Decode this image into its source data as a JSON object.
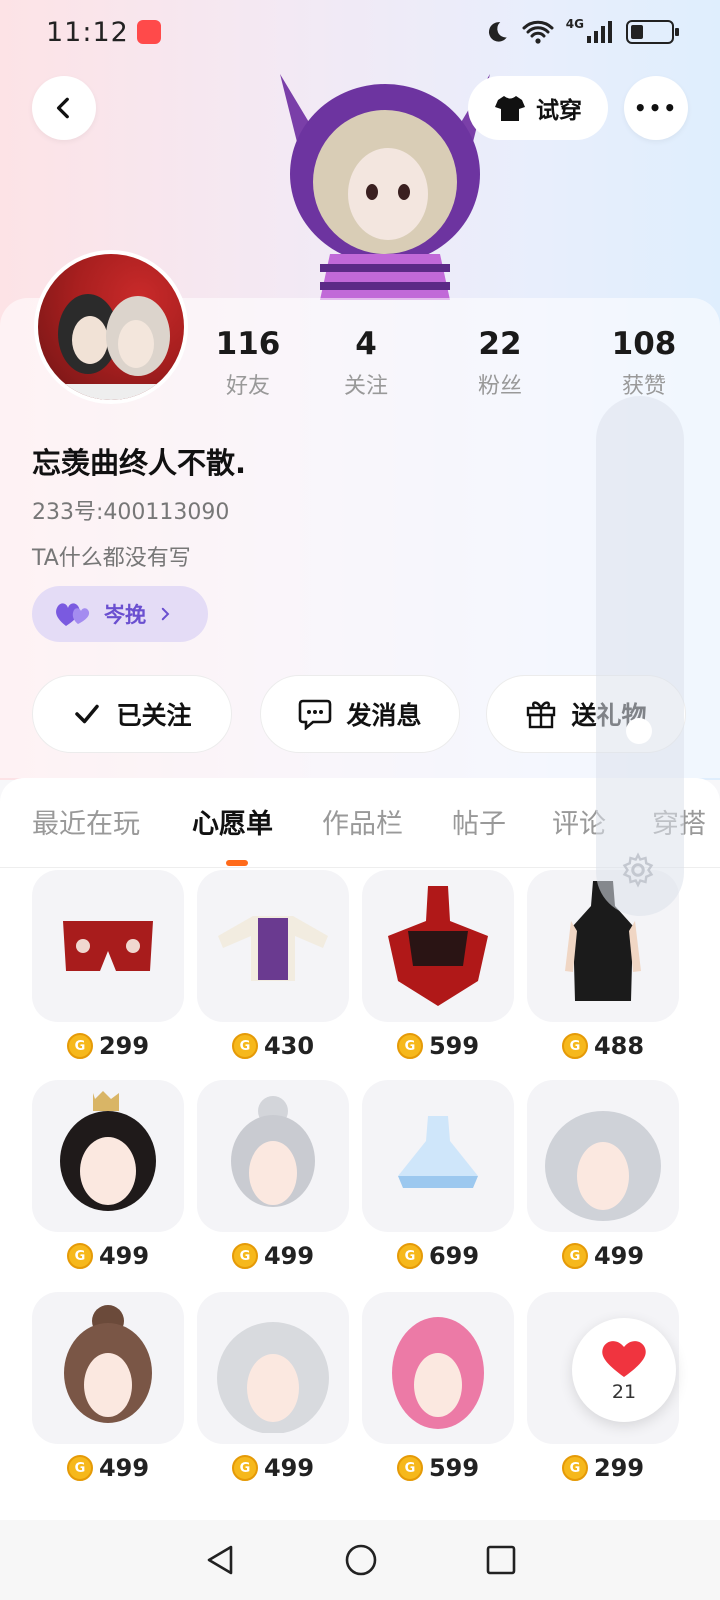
{
  "status_bar": {
    "time": "11:12",
    "network": "4G"
  },
  "header": {
    "tryon_label": "试穿",
    "more_label": "•••"
  },
  "profile": {
    "stats": [
      {
        "value": "116",
        "label": "好友"
      },
      {
        "value": "4",
        "label": "关注"
      },
      {
        "value": "22",
        "label": "粉丝"
      },
      {
        "value": "108",
        "label": "获赞"
      }
    ],
    "username": "忘羡曲终人不散.",
    "uid": "233号:400113090",
    "bio": "TA什么都没有写",
    "cp_chip": "岑挽"
  },
  "actions": {
    "follow_label": "已关注",
    "message_label": "发消息",
    "gift_label": "送礼物"
  },
  "tabs": [
    {
      "label": "最近在玩",
      "active": false
    },
    {
      "label": "心愿单",
      "active": true
    },
    {
      "label": "作品栏",
      "active": false
    },
    {
      "label": "帖子",
      "active": false
    },
    {
      "label": "评论",
      "active": false
    },
    {
      "label": "穿搭",
      "active": false
    }
  ],
  "wishlist": [
    {
      "price": "299",
      "kind": "shorts"
    },
    {
      "price": "430",
      "kind": "dress-purple"
    },
    {
      "price": "599",
      "kind": "dress-red"
    },
    {
      "price": "488",
      "kind": "dress-black"
    },
    {
      "price": "499",
      "kind": "hair-black-crown"
    },
    {
      "price": "499",
      "kind": "hair-silver-bun"
    },
    {
      "price": "699",
      "kind": "dress-blue"
    },
    {
      "price": "499",
      "kind": "hair-silver-long"
    },
    {
      "price": "499",
      "kind": "hair-brown-bun"
    },
    {
      "price": "499",
      "kind": "hair-silver-long2"
    },
    {
      "price": "599",
      "kind": "hair-pink"
    },
    {
      "price": "299",
      "kind": "hidden"
    }
  ],
  "like_fab": {
    "count": "21"
  },
  "colors": {
    "accent": "#ff6a1a",
    "coin": "#f6b81c",
    "chip": "#e4dcf6",
    "heart": "#f0343f"
  }
}
